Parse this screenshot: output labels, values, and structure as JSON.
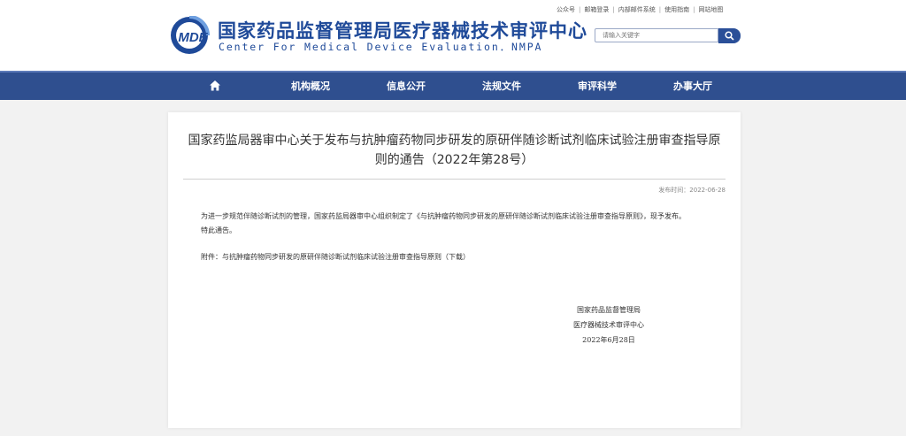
{
  "header": {
    "logo_text": "MDE",
    "title_cn": "国家药品监督管理局医疗器械技术审评中心",
    "title_en": "Center For Medical Device Evaluation．NMPA",
    "top_links": [
      "公众号",
      "邮箱登录",
      "内部邮件系统",
      "使用指南",
      "网站地图"
    ],
    "search": {
      "placeholder": "请输入关键字"
    },
    "brand_color": "#1f4a99"
  },
  "nav": {
    "items": [
      "机构概况",
      "信息公开",
      "法规文件",
      "审评科学",
      "办事大厅"
    ],
    "bg_color": "#2f4f8f"
  },
  "article": {
    "title_line1": "国家药监局器审中心关于发布与抗肿瘤药物同步研发的原研伴随诊断试剂临床试验注册审查指导原",
    "title_line2": "则的通告（2022年第28号）",
    "pub_date": "发布时间：2022-06-28",
    "para1": "为进一步规范伴随诊断试剂的管理，国家药监局器审中心组织制定了《与抗肿瘤药物同步研发的原研伴随诊断试剂临床试验注册审查指导原则》，现予发布。",
    "para2": "特此通告。",
    "attachment_prefix": "附件：",
    "attachment_link": "与抗肿瘤药物同步研发的原研伴随诊断试剂临床试验注册审查指导原则（下载）",
    "sign_org1": "国家药品监督管理局",
    "sign_org2": "医疗器械技术审评中心",
    "sign_date": "2022年6月28日"
  }
}
